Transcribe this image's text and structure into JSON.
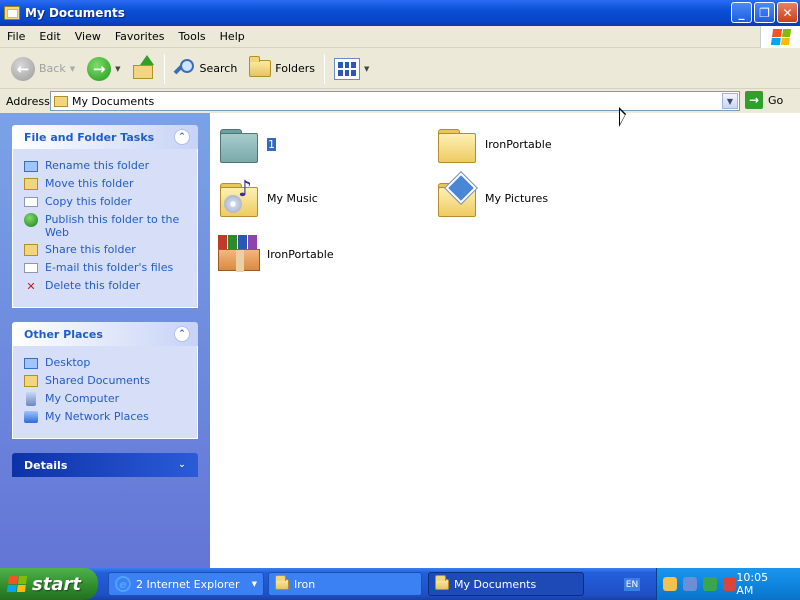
{
  "window": {
    "title": "My Documents",
    "buttons": {
      "minimize": "_",
      "maximize": "❐",
      "close": "✕"
    }
  },
  "menu": [
    "File",
    "Edit",
    "View",
    "Favorites",
    "Tools",
    "Help"
  ],
  "toolbar": {
    "back_label": "Back",
    "search_label": "Search",
    "folders_label": "Folders"
  },
  "address": {
    "label": "Address",
    "value": "My Documents",
    "go_label": "Go"
  },
  "file_tasks": {
    "title": "File and Folder Tasks",
    "items": [
      {
        "label": "Rename this folder",
        "icon": "rename-icon"
      },
      {
        "label": "Move this folder",
        "icon": "move-icon"
      },
      {
        "label": "Copy this folder",
        "icon": "copy-icon"
      },
      {
        "label": "Publish this folder to the Web",
        "icon": "publish-icon"
      },
      {
        "label": "Share this folder",
        "icon": "share-icon"
      },
      {
        "label": "E-mail this folder's files",
        "icon": "email-icon"
      },
      {
        "label": "Delete this folder",
        "icon": "delete-icon"
      }
    ]
  },
  "other_places": {
    "title": "Other Places",
    "items": [
      {
        "label": "Desktop",
        "icon": "desktop-icon"
      },
      {
        "label": "Shared Documents",
        "icon": "folder-icon"
      },
      {
        "label": "My Computer",
        "icon": "computer-icon"
      },
      {
        "label": "My Network Places",
        "icon": "network-icon"
      }
    ]
  },
  "details": {
    "title": "Details"
  },
  "files": [
    {
      "name": "1",
      "icon": "folder-icon",
      "selected": true
    },
    {
      "name": "IronPortable",
      "icon": "folder-icon",
      "selected": false
    },
    {
      "name": "My Music",
      "icon": "music-folder-icon",
      "selected": false
    },
    {
      "name": "My Pictures",
      "icon": "pictures-folder-icon",
      "selected": false
    },
    {
      "name": "IronPortable",
      "icon": "package-icon",
      "selected": false
    }
  ],
  "taskbar": {
    "start_label": "start",
    "tasks": [
      {
        "label": "2 Internet Explorer",
        "icon": "ie-icon"
      },
      {
        "label": "Iron",
        "icon": "folder-icon"
      },
      {
        "label": "My Documents",
        "icon": "folder-icon"
      }
    ],
    "language": "EN",
    "clock": "10:05 AM"
  },
  "colors": {
    "title_bar": "#0a4fd6",
    "task_pane": "#6375d6",
    "link": "#215dc6",
    "selection": "#316ac5"
  }
}
